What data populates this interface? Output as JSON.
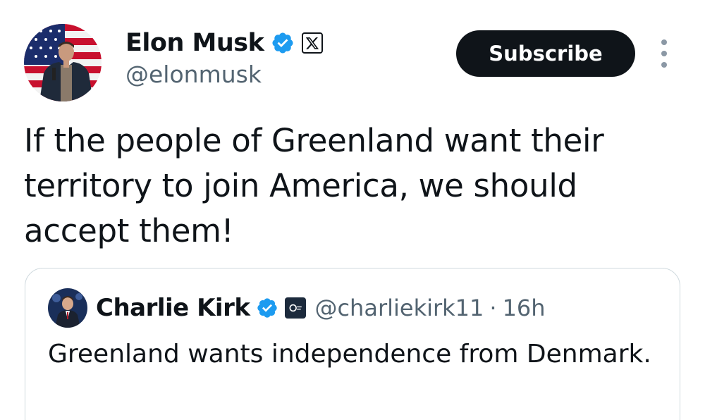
{
  "author": {
    "display_name": "Elon Musk",
    "handle": "@elonmusk",
    "verified_icon": "verified-badge-icon",
    "affiliation_icon": "x-logo-icon"
  },
  "actions": {
    "subscribe_label": "Subscribe",
    "more_icon": "more-vertical-icon"
  },
  "tweet": {
    "text": "If the people of Greenland want their territory to join America, we should accept them!"
  },
  "quoted": {
    "display_name": "Charlie Kirk",
    "handle": "@charliekirk11",
    "separator": "·",
    "time": "16h",
    "text": "Greenland wants independence from Denmark.",
    "verified_icon": "verified-badge-icon",
    "affiliation_icon": "organization-badge-icon"
  },
  "colors": {
    "text_primary": "#0f1419",
    "text_secondary": "#536471",
    "verified_blue": "#1d9bf0",
    "button_bg": "#0f1419",
    "border": "#cfd9de"
  }
}
